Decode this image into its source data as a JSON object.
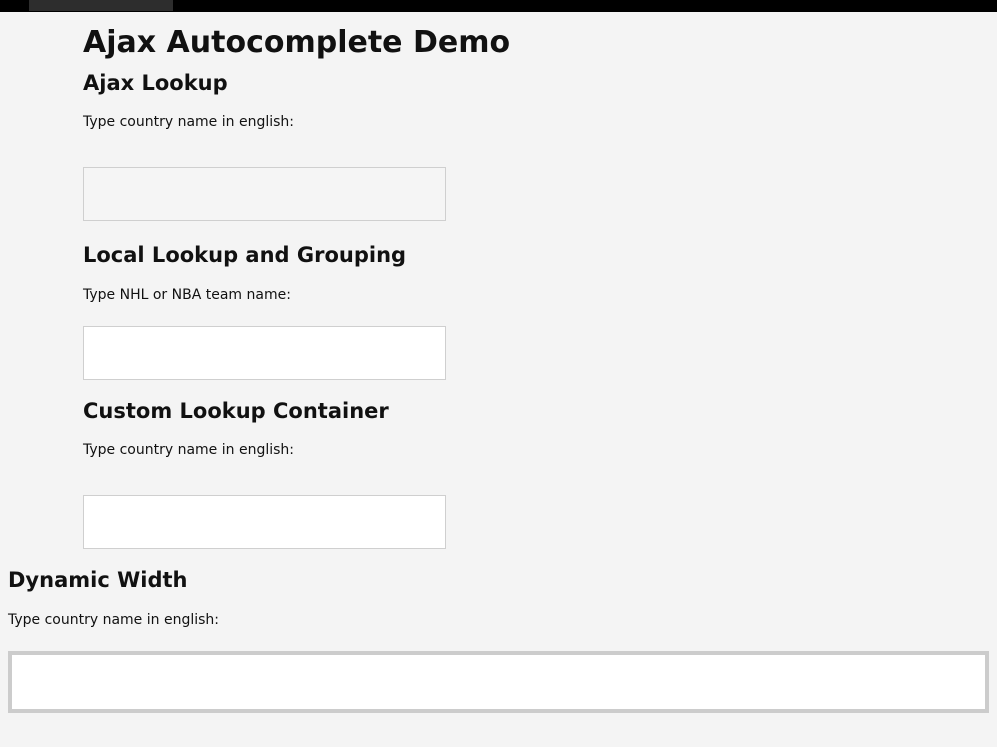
{
  "page": {
    "title": "Ajax Autocomplete Demo"
  },
  "sections": {
    "ajax": {
      "heading": "Ajax Lookup",
      "label": "Type country name in english:",
      "input_value": "",
      "placeholder": ""
    },
    "local": {
      "heading": "Local Lookup and Grouping",
      "label": "Type NHL or NBA team name:",
      "input_value": "",
      "placeholder": ""
    },
    "custom": {
      "heading": "Custom Lookup Container",
      "label": "Type country name in english:",
      "input_value": "",
      "placeholder": ""
    },
    "dynamic": {
      "heading": "Dynamic Width",
      "label": "Type country name in english:",
      "input_value": "",
      "placeholder": ""
    }
  },
  "colors": {
    "background": "#f4f4f4",
    "topbar": "#000000",
    "topbar_tab": "#2d2d2d",
    "input_border": "#cfcfcf",
    "dynamic_border": "#cccccc"
  }
}
